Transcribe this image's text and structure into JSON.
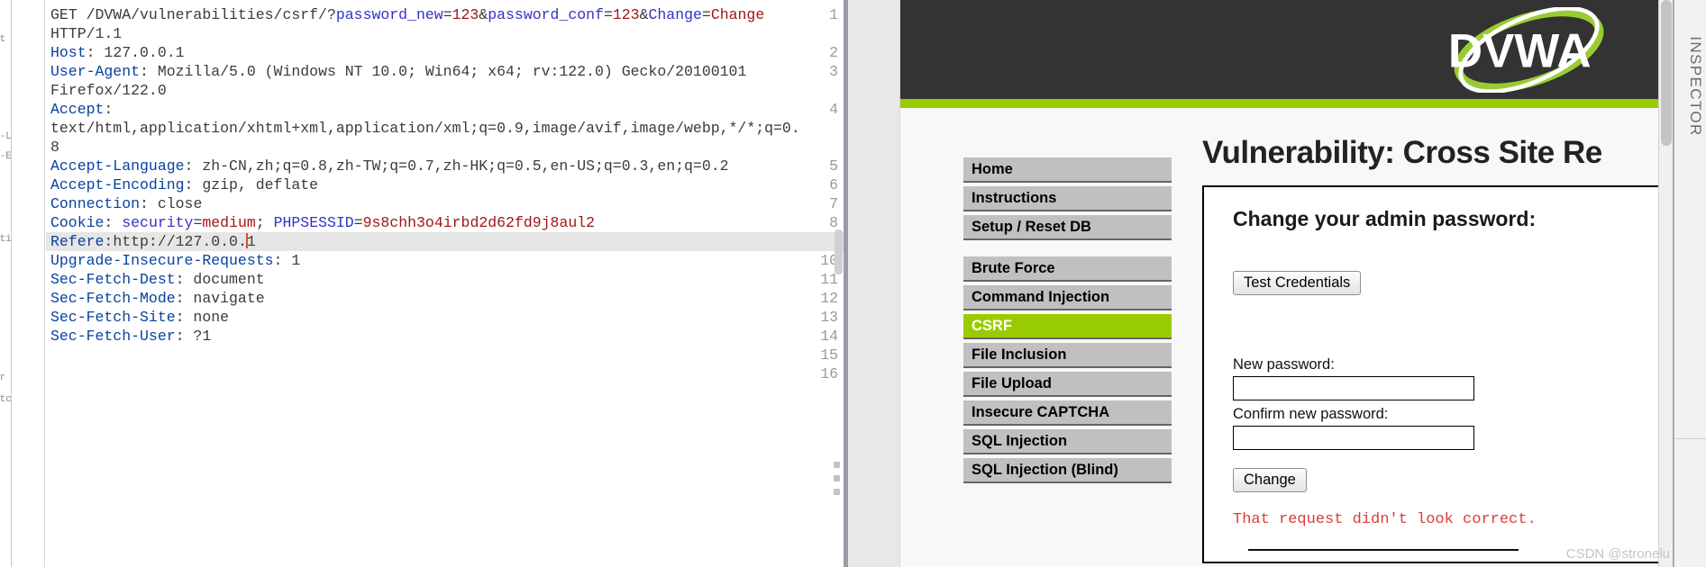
{
  "request_editor": {
    "name": "http-request-raw-view",
    "lines": [
      {
        "n": 1,
        "segments": [
          {
            "t": "GET /DVWA/vulnerabilities/csrf/?",
            "c": "v"
          },
          {
            "t": "password_new",
            "c": "pb"
          },
          {
            "t": "=",
            "c": "v"
          },
          {
            "t": "123",
            "c": "pr"
          },
          {
            "t": "&",
            "c": "v"
          },
          {
            "t": "password_conf",
            "c": "pb"
          },
          {
            "t": "=",
            "c": "v"
          },
          {
            "t": "123",
            "c": "pr"
          },
          {
            "t": "&",
            "c": "v"
          },
          {
            "t": "Change",
            "c": "pb"
          },
          {
            "t": "=",
            "c": "v"
          },
          {
            "t": "Change",
            "c": "pr"
          }
        ]
      },
      {
        "n": null,
        "segments": [
          {
            "t": "HTTP/1.1",
            "c": "v"
          }
        ]
      },
      {
        "n": 2,
        "segments": [
          {
            "t": "Host",
            "c": "k"
          },
          {
            "t": ": 127.0.0.1",
            "c": "v"
          }
        ]
      },
      {
        "n": 3,
        "segments": [
          {
            "t": "User-Agent",
            "c": "k"
          },
          {
            "t": ": Mozilla/5.0 (Windows NT 10.0; Win64; x64; rv:122.0) Gecko/20100101",
            "c": "v"
          }
        ]
      },
      {
        "n": null,
        "segments": [
          {
            "t": "Firefox/122.0",
            "c": "v"
          }
        ]
      },
      {
        "n": 4,
        "segments": [
          {
            "t": "Accept",
            "c": "k"
          },
          {
            "t": ":",
            "c": "v"
          }
        ]
      },
      {
        "n": null,
        "segments": [
          {
            "t": "text/html,application/xhtml+xml,application/xml;q=0.9,image/avif,image/webp,*/*;q=0.",
            "c": "v"
          }
        ]
      },
      {
        "n": null,
        "segments": [
          {
            "t": "8",
            "c": "v"
          }
        ]
      },
      {
        "n": 5,
        "segments": [
          {
            "t": "Accept-Language",
            "c": "k"
          },
          {
            "t": ": zh-CN,zh;q=0.8,zh-TW;q=0.7,zh-HK;q=0.5,en-US;q=0.3,en;q=0.2",
            "c": "v"
          }
        ]
      },
      {
        "n": 6,
        "segments": [
          {
            "t": "Accept-Encoding",
            "c": "k"
          },
          {
            "t": ": gzip, deflate",
            "c": "v"
          }
        ]
      },
      {
        "n": 7,
        "segments": [
          {
            "t": "Connection",
            "c": "k"
          },
          {
            "t": ": close",
            "c": "v"
          }
        ]
      },
      {
        "n": 8,
        "segments": [
          {
            "t": "Cookie",
            "c": "k"
          },
          {
            "t": ": ",
            "c": "v"
          },
          {
            "t": "security",
            "c": "pb"
          },
          {
            "t": "=",
            "c": "v"
          },
          {
            "t": "medium",
            "c": "pr"
          },
          {
            "t": "; ",
            "c": "v"
          },
          {
            "t": "PHPSESSID",
            "c": "pb"
          },
          {
            "t": "=",
            "c": "v"
          },
          {
            "t": "9s8chh3o4irbd2d62fd9j8aul2",
            "c": "pr"
          }
        ]
      },
      {
        "n": 9,
        "highlight": true,
        "caret_after": 21,
        "segments": [
          {
            "t": "Refere",
            "c": "k"
          },
          {
            "t": ":http://127.0.0.",
            "c": "v"
          },
          {
            "t": "1",
            "c": "v"
          }
        ]
      },
      {
        "n": 10,
        "segments": [
          {
            "t": "Upgrade-Insecure-Requests",
            "c": "k"
          },
          {
            "t": ": 1",
            "c": "v"
          }
        ]
      },
      {
        "n": 11,
        "segments": [
          {
            "t": "Sec-Fetch-Dest",
            "c": "k"
          },
          {
            "t": ": document",
            "c": "v"
          }
        ]
      },
      {
        "n": 12,
        "segments": [
          {
            "t": "Sec-Fetch-Mode",
            "c": "k"
          },
          {
            "t": ": navigate",
            "c": "v"
          }
        ]
      },
      {
        "n": 13,
        "segments": [
          {
            "t": "Sec-Fetch-Site",
            "c": "k"
          },
          {
            "t": ": none",
            "c": "v"
          }
        ]
      },
      {
        "n": 14,
        "segments": [
          {
            "t": "Sec-Fetch-User",
            "c": "k"
          },
          {
            "t": ": ?1",
            "c": "v"
          }
        ]
      },
      {
        "n": 15,
        "segments": []
      },
      {
        "n": 16,
        "segments": []
      }
    ]
  },
  "dvwa": {
    "logo_text": "DVWA",
    "nav": {
      "groups": [
        {
          "items": [
            {
              "label": "Home",
              "active": false
            },
            {
              "label": "Instructions",
              "active": false
            },
            {
              "label": "Setup / Reset DB",
              "active": false
            }
          ]
        },
        {
          "items": [
            {
              "label": "Brute Force",
              "active": false
            },
            {
              "label": "Command Injection",
              "active": false
            },
            {
              "label": "CSRF",
              "active": true
            },
            {
              "label": "File Inclusion",
              "active": false
            },
            {
              "label": "File Upload",
              "active": false
            },
            {
              "label": "Insecure CAPTCHA",
              "active": false
            },
            {
              "label": "SQL Injection",
              "active": false
            },
            {
              "label": "SQL Injection (Blind)",
              "active": false
            }
          ]
        }
      ]
    },
    "page_title": "Vulnerability: Cross Site Re",
    "form": {
      "heading": "Change your admin password:",
      "test_credentials_label": "Test Credentials",
      "new_password_label": "New password:",
      "new_password_value": "",
      "confirm_password_label": "Confirm new password:",
      "confirm_password_value": "",
      "change_button_label": "Change",
      "error_message": "That request didn't look correct."
    }
  },
  "inspector_rail": {
    "label": "INSPECTOR"
  },
  "watermark": {
    "text": "CSDN @stronelu"
  },
  "colors": {
    "dvwa_green": "#99cc00",
    "header_dark": "#333333",
    "nav_gray": "#c0c0c0",
    "error_red": "#e03a3a",
    "param_blue": "#3232c8",
    "param_red": "#a11616",
    "header_key_blue": "#0842a0"
  }
}
